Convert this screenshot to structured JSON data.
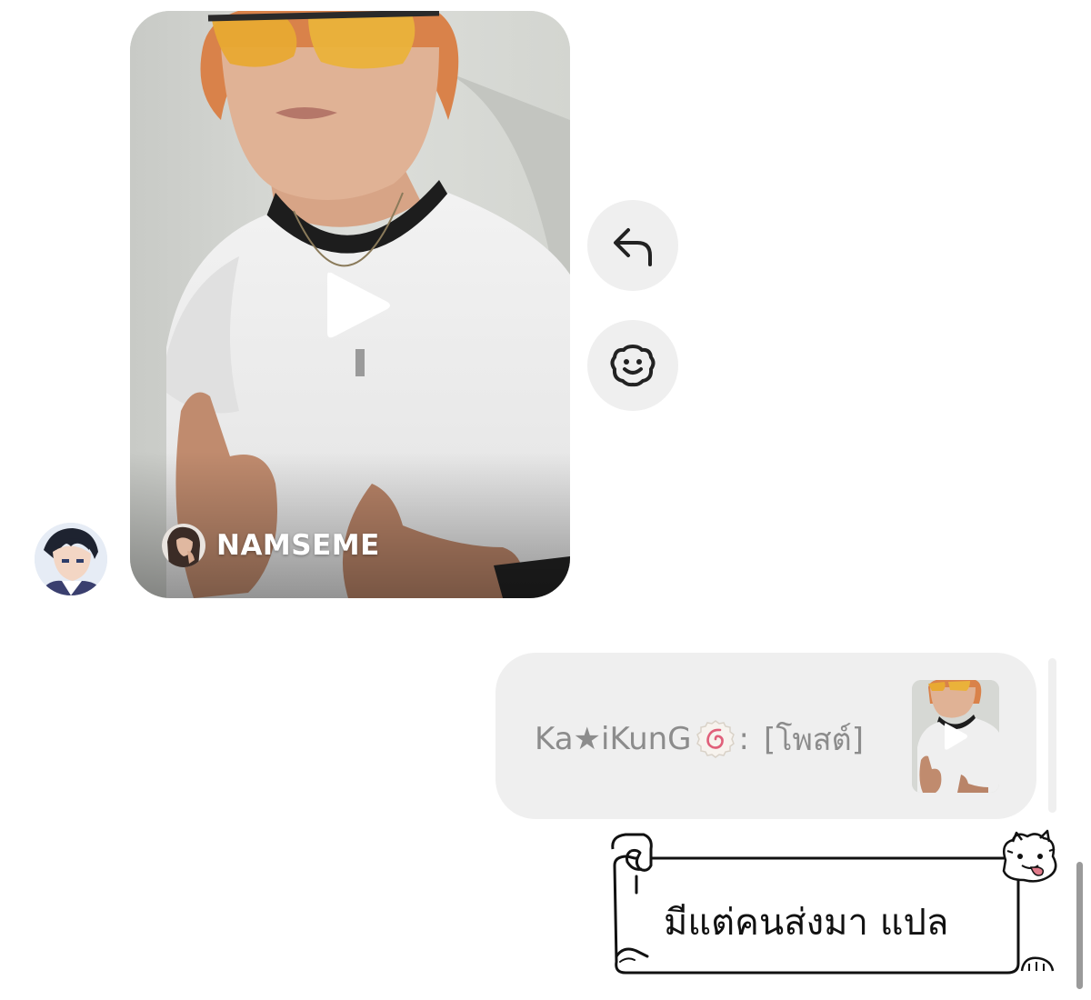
{
  "thread": {
    "shared_reel": {
      "owner_username": "NAMSEME",
      "play_icon": "play-icon"
    },
    "actions": {
      "reply_icon": "reply-icon",
      "react_icon": "react-icon"
    },
    "outgoing_reply": {
      "quoted_sender": "Ka★iKunG",
      "sender_emoji": "narutomaki-icon",
      "separator": ":",
      "quoted_content": "[โพสต์]"
    },
    "message": {
      "text": "มีแต่คนส่งมา แปล",
      "style": "scroll-sticker"
    }
  },
  "colors": {
    "bubble_bg": "#efefef",
    "quote_text": "#8c8c8c",
    "message_text": "#111111",
    "owner_name": "#ffffff"
  }
}
